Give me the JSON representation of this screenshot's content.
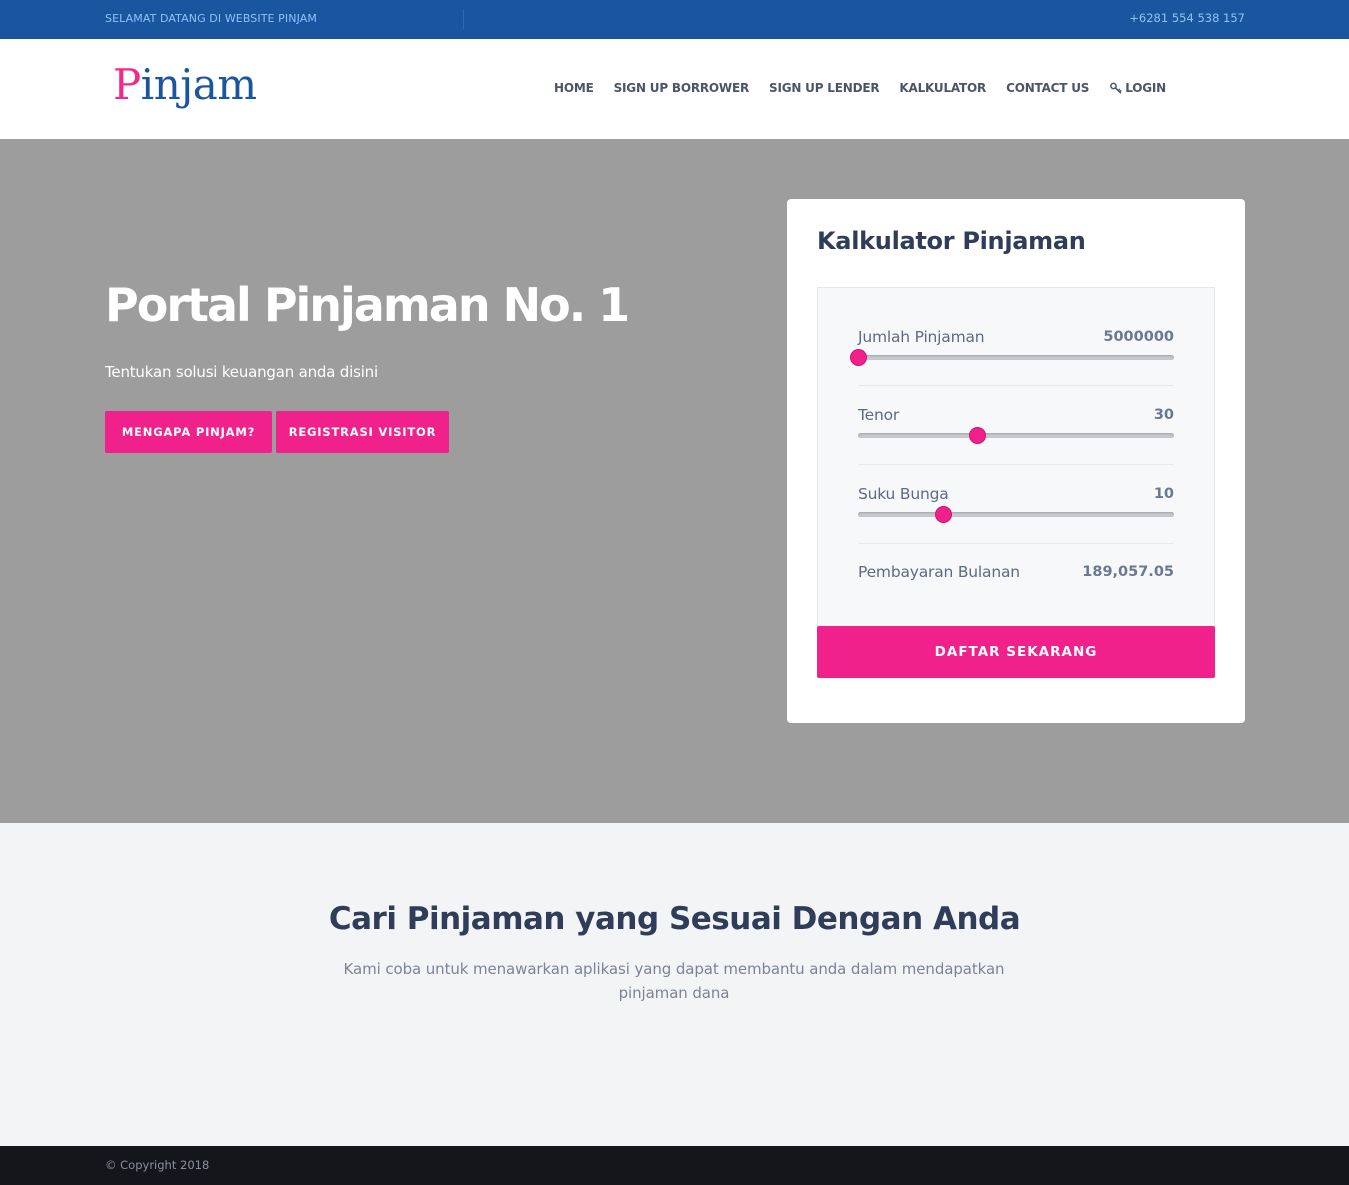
{
  "topbar": {
    "welcome": "SELAMAT DATANG DI WEBSITE PINJAM",
    "phone": "+6281 554 538 157"
  },
  "header": {
    "logo_first": "P",
    "logo_rest": "injam",
    "nav": [
      "HOME",
      "SIGN UP BORROWER",
      "SIGN UP LENDER",
      "KALKULATOR",
      "CONTACT US"
    ],
    "login": "LOGIN",
    "login_icon": "key-icon"
  },
  "hero": {
    "title": "Portal Pinjaman No. 1",
    "subtitle": "Tentukan solusi keuangan anda disini",
    "buttons": [
      "MENGAPA PINJAM?",
      "REGISTRASI VISITOR"
    ]
  },
  "calculator": {
    "title": "Kalkulator Pinjaman",
    "sliders": [
      {
        "label": "Jumlah Pinjaman",
        "value": "5000000",
        "fraction": 0.0
      },
      {
        "label": "Tenor",
        "value": "30",
        "fraction": 0.375
      },
      {
        "label": "Suku Bunga",
        "value": "10",
        "fraction": 0.27
      }
    ],
    "result_label": "Pembayaran Bulanan",
    "result_value": "189,057.05",
    "cta": "DAFTAR SEKARANG"
  },
  "section": {
    "title": "Cari Pinjaman yang Sesuai Dengan Anda",
    "subtitle": "Kami coba untuk menawarkan aplikasi yang dapat membantu anda dalam mendapatkan pinjaman dana"
  },
  "footer": {
    "copyright": "© Copyright 2018"
  },
  "colors": {
    "topbar": "#1a56a0",
    "accent": "#f0218a",
    "hero_bg": "#9c9d9c",
    "footer_bg": "#14161b"
  }
}
